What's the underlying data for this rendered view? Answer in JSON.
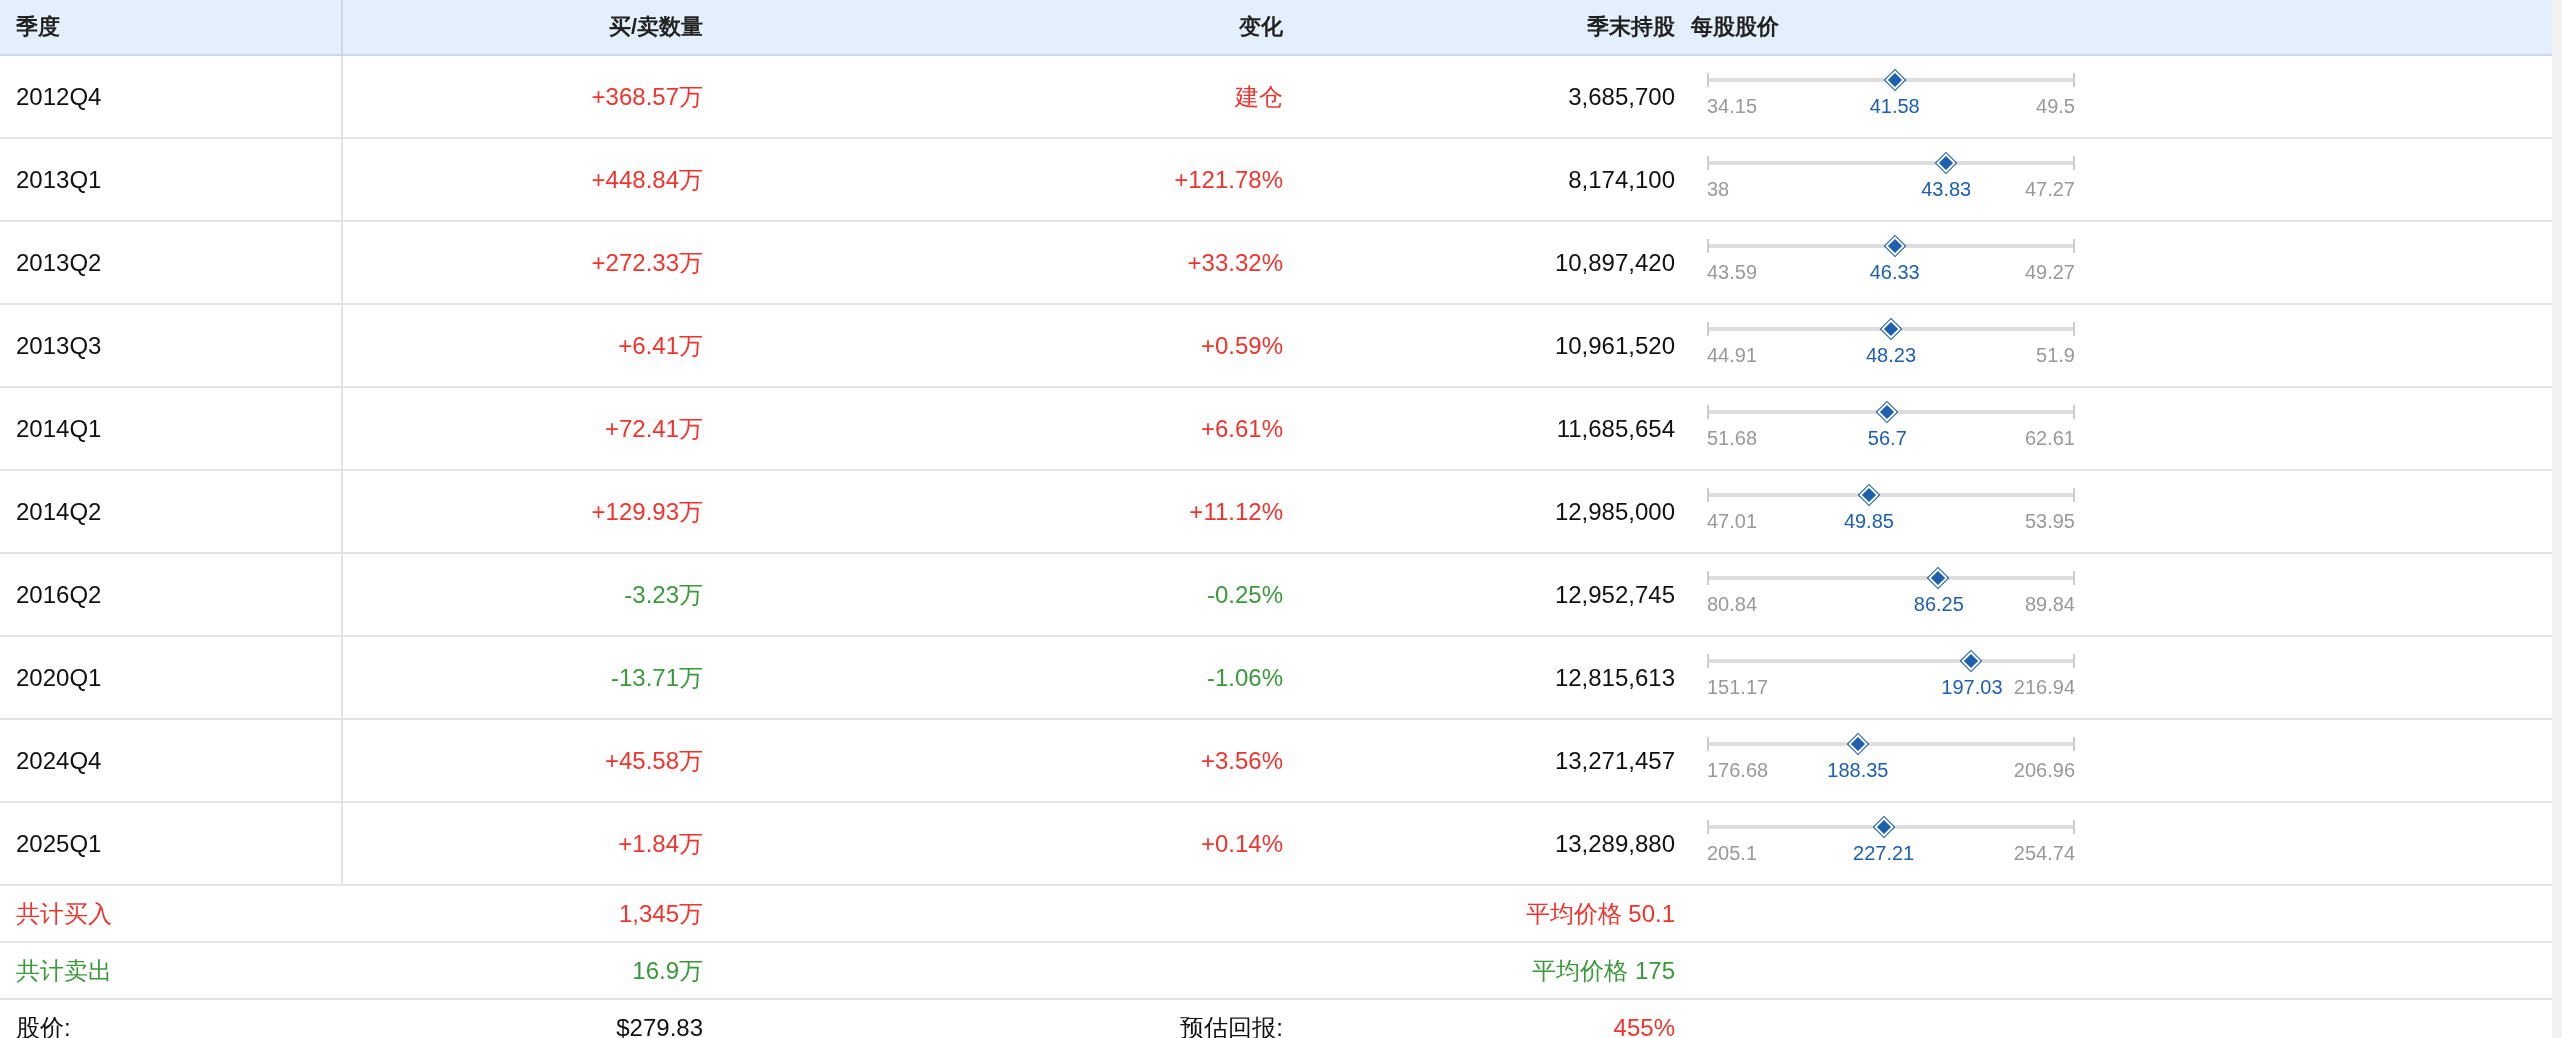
{
  "table": {
    "columns": [
      "季度",
      "买/卖数量",
      "变化",
      "季末持股",
      "每股股价"
    ],
    "rows": [
      {
        "quarter": "2012Q4",
        "kind": "buy",
        "quantity": "+368.57万",
        "change": "建仓",
        "holding": "3,685,700",
        "price": {
          "low": "34.15",
          "avg": "41.58",
          "high": "49.5",
          "level": 0.51
        }
      },
      {
        "quarter": "2013Q1",
        "kind": "buy",
        "quantity": "+448.84万",
        "change": "+121.78%",
        "holding": "8,174,100",
        "price": {
          "low": "38",
          "avg": "43.83",
          "high": "47.27",
          "level": 0.65
        }
      },
      {
        "quarter": "2013Q2",
        "kind": "buy",
        "quantity": "+272.33万",
        "change": "+33.32%",
        "holding": "10,897,420",
        "price": {
          "low": "43.59",
          "avg": "46.33",
          "high": "49.27",
          "level": 0.51
        }
      },
      {
        "quarter": "2013Q3",
        "kind": "buy",
        "quantity": "+6.41万",
        "change": "+0.59%",
        "holding": "10,961,520",
        "price": {
          "low": "44.91",
          "avg": "48.23",
          "high": "51.9",
          "level": 0.5
        }
      },
      {
        "quarter": "2014Q1",
        "kind": "buy",
        "quantity": "+72.41万",
        "change": "+6.61%",
        "holding": "11,685,654",
        "price": {
          "low": "51.68",
          "avg": "56.7",
          "high": "62.61",
          "level": 0.49
        }
      },
      {
        "quarter": "2014Q2",
        "kind": "buy",
        "quantity": "+129.93万",
        "change": "+11.12%",
        "holding": "12,985,000",
        "price": {
          "low": "47.01",
          "avg": "49.85",
          "high": "53.95",
          "level": 0.44
        }
      },
      {
        "quarter": "2016Q2",
        "kind": "sell",
        "quantity": "-3.23万",
        "change": "-0.25%",
        "holding": "12,952,745",
        "price": {
          "low": "80.84",
          "avg": "86.25",
          "high": "89.84",
          "level": 0.63
        }
      },
      {
        "quarter": "2020Q1",
        "kind": "sell",
        "quantity": "-13.71万",
        "change": "-1.06%",
        "holding": "12,815,613",
        "price": {
          "low": "151.17",
          "avg": "197.03",
          "high": "216.94",
          "level": 0.72
        }
      },
      {
        "quarter": "2024Q4",
        "kind": "buy",
        "quantity": "+45.58万",
        "change": "+3.56%",
        "holding": "13,271,457",
        "price": {
          "low": "176.68",
          "avg": "188.35",
          "high": "206.96",
          "level": 0.41
        }
      },
      {
        "quarter": "2025Q1",
        "kind": "buy",
        "quantity": "+1.84万",
        "change": "+0.14%",
        "holding": "13,289,880",
        "price": {
          "low": "205.1",
          "avg": "227.21",
          "high": "254.74",
          "level": 0.48
        }
      }
    ]
  },
  "summary": [
    {
      "kind": "buy",
      "label": "共计买入",
      "amount": "1,345万",
      "value": "平均价格 50.1"
    },
    {
      "kind": "sell",
      "label": "共计卖出",
      "amount": "16.9万",
      "value": "平均价格 175"
    },
    {
      "kind": "price",
      "label": "股价:",
      "amount": "$279.83",
      "value_label": "预估回报:",
      "value": "455%"
    }
  ]
}
